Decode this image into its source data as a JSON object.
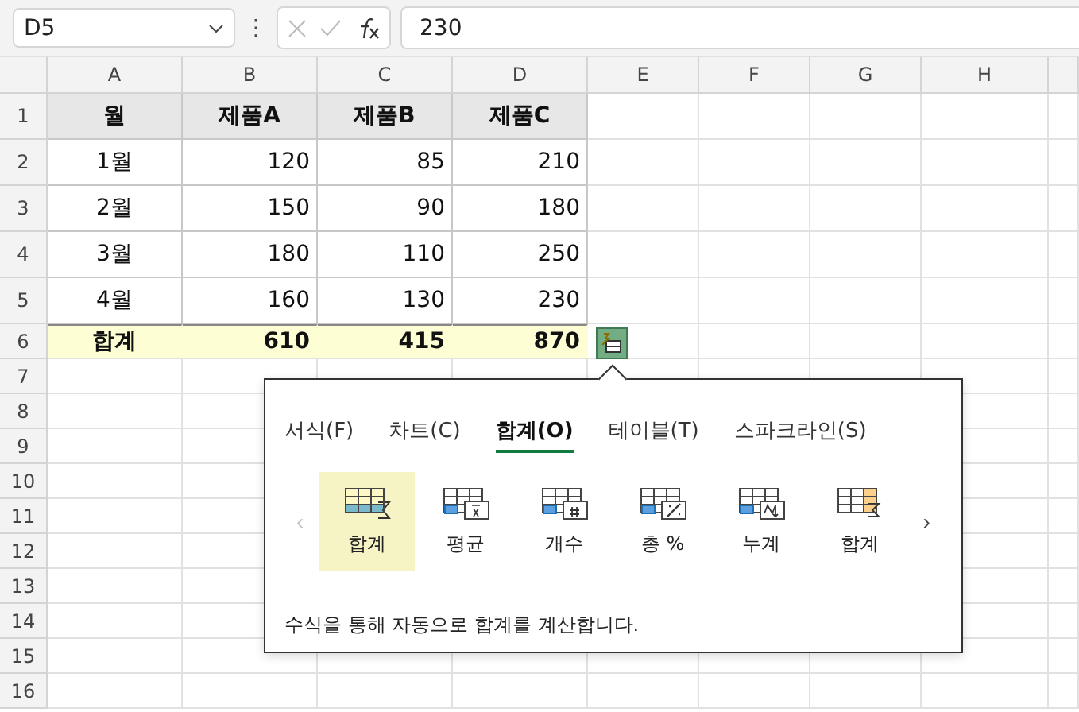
{
  "formula_bar": {
    "name_box": "D5",
    "more": "⋮",
    "formula": "230"
  },
  "sheet": {
    "columns": [
      "A",
      "B",
      "C",
      "D",
      "E",
      "F",
      "G",
      "H"
    ],
    "row_numbers": [
      "1",
      "2",
      "3",
      "4",
      "5",
      "6",
      "7",
      "8",
      "9",
      "10",
      "11",
      "12",
      "13",
      "14",
      "15",
      "16"
    ],
    "rows": [
      {
        "kind": "header",
        "cells": [
          "월",
          "제품A",
          "제품B",
          "제품C"
        ]
      },
      {
        "kind": "data",
        "cells": [
          "1월",
          "120",
          "85",
          "210"
        ]
      },
      {
        "kind": "data",
        "cells": [
          "2월",
          "150",
          "90",
          "180"
        ]
      },
      {
        "kind": "data",
        "cells": [
          "3월",
          "180",
          "110",
          "250"
        ]
      },
      {
        "kind": "data",
        "cells": [
          "4월",
          "160",
          "130",
          "230"
        ]
      },
      {
        "kind": "total",
        "cells": [
          "합계",
          "610",
          "415",
          "870"
        ]
      }
    ]
  },
  "quick_analysis": {
    "tabs": [
      {
        "label": "서식(F)",
        "selected": false
      },
      {
        "label": "차트(C)",
        "selected": false
      },
      {
        "label": "합계(O)",
        "selected": true
      },
      {
        "label": "테이블(T)",
        "selected": false
      },
      {
        "label": "스파크라인(S)",
        "selected": false
      }
    ],
    "prev": {
      "label": "‹",
      "disabled": true
    },
    "next": {
      "label": "›",
      "disabled": false
    },
    "items": [
      {
        "kind": "sum",
        "label": "합계",
        "selected": true
      },
      {
        "kind": "average",
        "label": "평균",
        "selected": false
      },
      {
        "kind": "count",
        "label": "개수",
        "selected": false
      },
      {
        "kind": "percent",
        "label": "총 %",
        "selected": false
      },
      {
        "kind": "running",
        "label": "누계",
        "selected": false
      },
      {
        "kind": "sum_column",
        "label": "합계",
        "selected": false
      }
    ],
    "description": "수식을 통해 자동으로 합계를 계산합니다."
  }
}
